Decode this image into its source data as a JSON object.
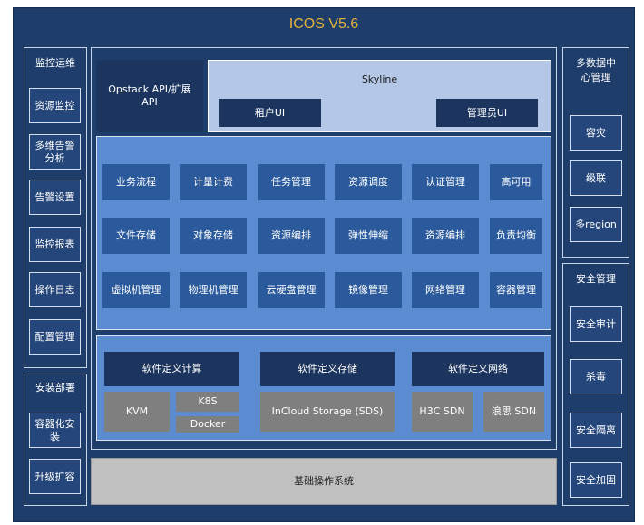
{
  "title": "ICOS V5.6",
  "left_monitor": {
    "title": "监控运维",
    "items": [
      "资源监控",
      "多维告警\n分析",
      "告警设置",
      "监控报表",
      "操作日志",
      "配置管理"
    ]
  },
  "left_install": {
    "title": "安装部署",
    "items": [
      "容器化安\n装",
      "升级扩容"
    ]
  },
  "right_multidc": {
    "title": "多数据中\n心管理",
    "items": [
      "容灾",
      "级联",
      "多region"
    ]
  },
  "right_security": {
    "title": "安全管理",
    "items": [
      "安全审计",
      "杀毒",
      "安全隔离",
      "安全加固"
    ]
  },
  "api": {
    "label": "Opstack API/扩展\nAPI"
  },
  "skyline": {
    "title": "Skyline",
    "tenant_ui": "租户UI",
    "admin_ui": "管理员UI"
  },
  "features": {
    "row1": [
      "业务流程",
      "计量计费",
      "任务管理",
      "资源调度",
      "认证管理",
      "高可用"
    ],
    "row2": [
      "文件存储",
      "对象存储",
      "资源编排",
      "弹性伸缩",
      "资源编排",
      "负责均衡"
    ],
    "row3": [
      "虚拟机管理",
      "物理机管理",
      "云硬盘管理",
      "镜像管理",
      "网络管理",
      "容器管理"
    ]
  },
  "software": {
    "compute": "软件定义计算",
    "storage": "软件定义存储",
    "network": "软件定义网络",
    "kvm": "KVM",
    "k8s": "K8S",
    "docker": "Docker",
    "incloud": "InCloud Storage (SDS)",
    "h3c": "H3C SDN",
    "langsi": "浪思 SDN"
  },
  "base_os": "基础操作系统"
}
